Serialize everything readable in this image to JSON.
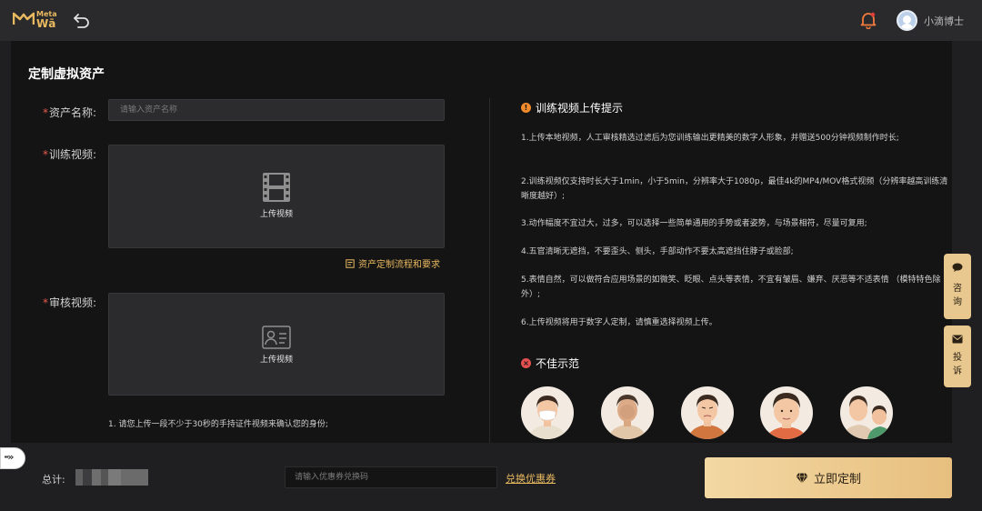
{
  "header": {
    "logo_top": "Meta",
    "logo_bottom": "Wā",
    "username": "小滴博士",
    "icons": {
      "back": "undo-arrow-icon",
      "notification": "bell-icon",
      "avatar": "user-avatar"
    },
    "accent_color": "#e9b95f"
  },
  "page": {
    "title": "定制虚拟资产"
  },
  "form": {
    "asset_name": {
      "label": "资产名称:",
      "placeholder": "请输入资产名称"
    },
    "training_video": {
      "label": "训练视频:",
      "upload_label": "上传视频",
      "icon": "film-icon"
    },
    "flow_link": "资产定制流程和要求",
    "review_video": {
      "label": "审核视频:",
      "upload_label": "上传视频",
      "icon": "id-card-icon"
    },
    "review_note": "1. 请您上传一段不少于30秒的手持证件视频来确认您的身份;"
  },
  "tips": {
    "title": "训练视频上传提示",
    "items": [
      "1.上传本地视频，人工审核精选过滤后为您训练输出更精美的数字人形象，并赠送500分钟视频制作时长;",
      "2.训练视频仅支持时长大于1min，小于5min，分辨率大于1080p，最佳4k的MP4/MOV格式视频（分辨率越高训练清晰度越好）;",
      "3.动作幅度不宜过大，过多，可以选择一些简单通用的手势或者姿势，与场景相符，尽量可复用;",
      "4.五官清晰无遮挡，不要歪头、侧头，手部动作不要太高遮挡住脖子或脸部;",
      "5.表情自然，可以做符合应用场景的如微笑、眨眼、点头等表情，不宜有皱眉、嫌弃、厌恶等不适表情 （模特特色除外）;",
      "6.上传视频将用于数字人定制，请慎重选择视频上传。"
    ],
    "bad_examples_title": "不佳示范"
  },
  "side_buttons": [
    {
      "label_1": "咨",
      "label_2": "询",
      "icon": "chat-bubble-icon"
    },
    {
      "label_1": "投",
      "label_2": "诉",
      "icon": "mail-icon"
    }
  ],
  "footer": {
    "total_label": "总计:",
    "coupon_placeholder": "请输入优惠券兑换码",
    "coupon_link": "兑换优惠券",
    "submit_label": "立即定制",
    "submit_icon": "diamond-icon"
  }
}
